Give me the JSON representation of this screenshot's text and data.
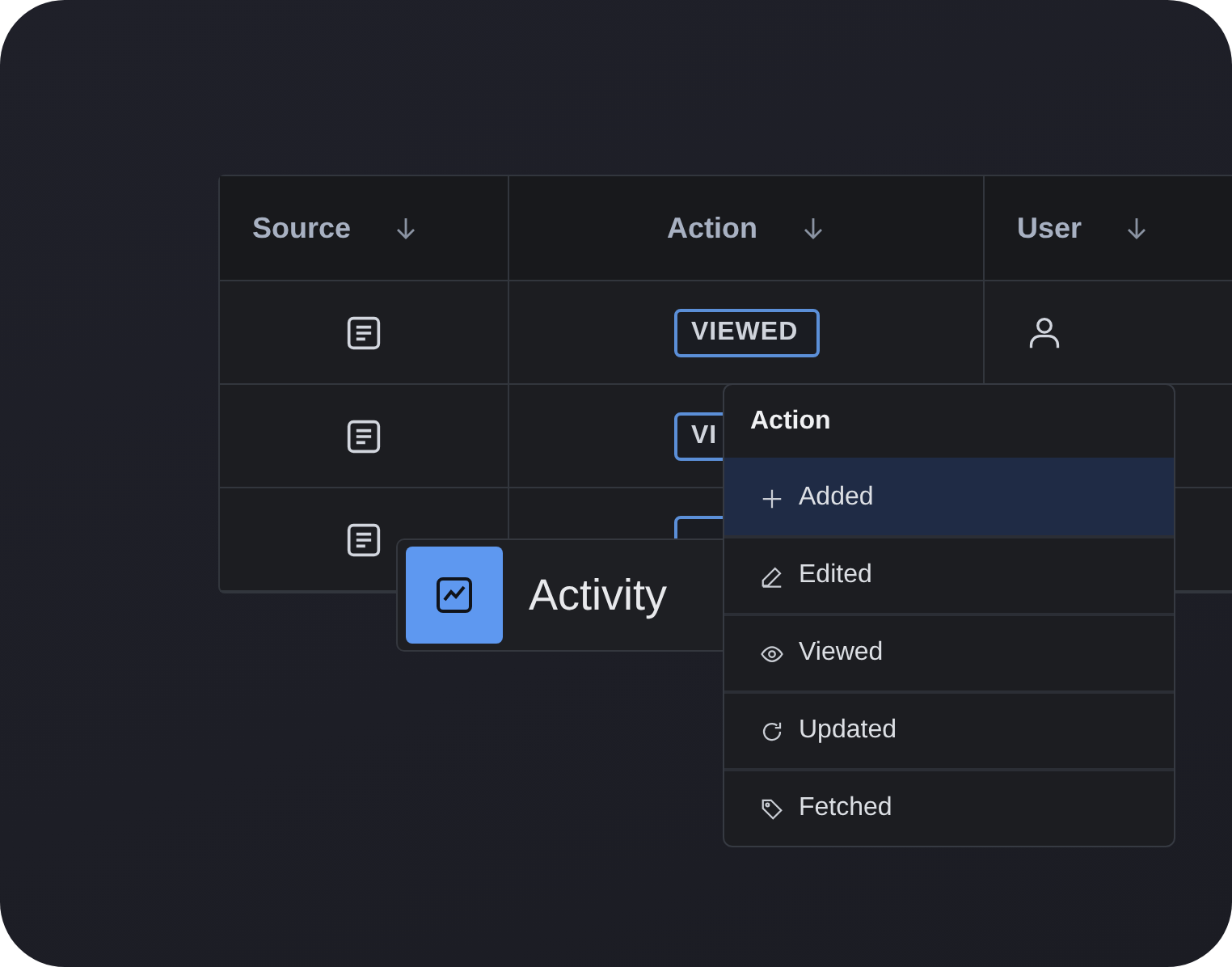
{
  "table": {
    "columns": [
      {
        "label": "Source"
      },
      {
        "label": "Action"
      },
      {
        "label": "User"
      }
    ],
    "rows": [
      {
        "tag": true,
        "action": "VIEWED"
      },
      {
        "tag": true,
        "action": "VI"
      },
      {
        "tag": true
      }
    ]
  },
  "widget": {
    "label": "Activity"
  },
  "dropdown": {
    "title": "Action",
    "items": [
      {
        "label": "Added",
        "selected": true
      },
      {
        "label": "Edited",
        "selected": false
      },
      {
        "label": "Viewed",
        "selected": false
      },
      {
        "label": "Updated",
        "selected": false
      },
      {
        "label": "Fetched",
        "selected": false
      }
    ]
  }
}
